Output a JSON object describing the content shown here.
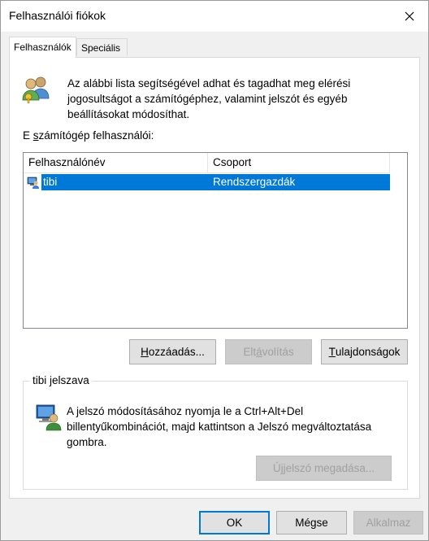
{
  "window": {
    "title": "Felhasználói fiókok"
  },
  "tabs": [
    {
      "label": "Felhasználók",
      "active": true
    },
    {
      "label": "Speciális",
      "active": false
    }
  ],
  "intro": {
    "text": "Az alábbi lista segítségével adhat és tagadhat meg elérési jogosultságot a számítógéphez, valamint jelszót és egyéb beállításokat módosíthat.",
    "icon": "users-icon"
  },
  "users_list": {
    "label_prefix": "E ",
    "label_accel": "s",
    "label_rest": "zámítógép felhasználói:",
    "columns": [
      "Felhasználónév",
      "Csoport"
    ],
    "rows": [
      {
        "username": "tibi",
        "group": "Rendszergazdák",
        "selected": true
      }
    ]
  },
  "buttons": {
    "add": {
      "pre": "",
      "accel": "H",
      "post": "ozzáadás...",
      "enabled": true
    },
    "remove": {
      "pre": "Elt",
      "accel": "á",
      "post": "volítás",
      "enabled": false
    },
    "properties": {
      "pre": "",
      "accel": "T",
      "post": "ulajdonságok",
      "enabled": true
    }
  },
  "password_group": {
    "title": "tibi jelszava",
    "text": "A jelszó módosításához nyomja le a Ctrl+Alt+Del billentyűkombinációt, majd kattintson a Jelszó megváltoztatása gombra.",
    "button": {
      "pre": "Ú",
      "accel": "j",
      "post": " jelszó megadása...",
      "enabled": false
    }
  },
  "footer": {
    "ok": "OK",
    "cancel": "Mégse",
    "apply": "Alkalmaz"
  },
  "colors": {
    "selection": "#0078d7",
    "button_face": "#e1e1e1",
    "disabled_text": "#a0a0a0"
  }
}
